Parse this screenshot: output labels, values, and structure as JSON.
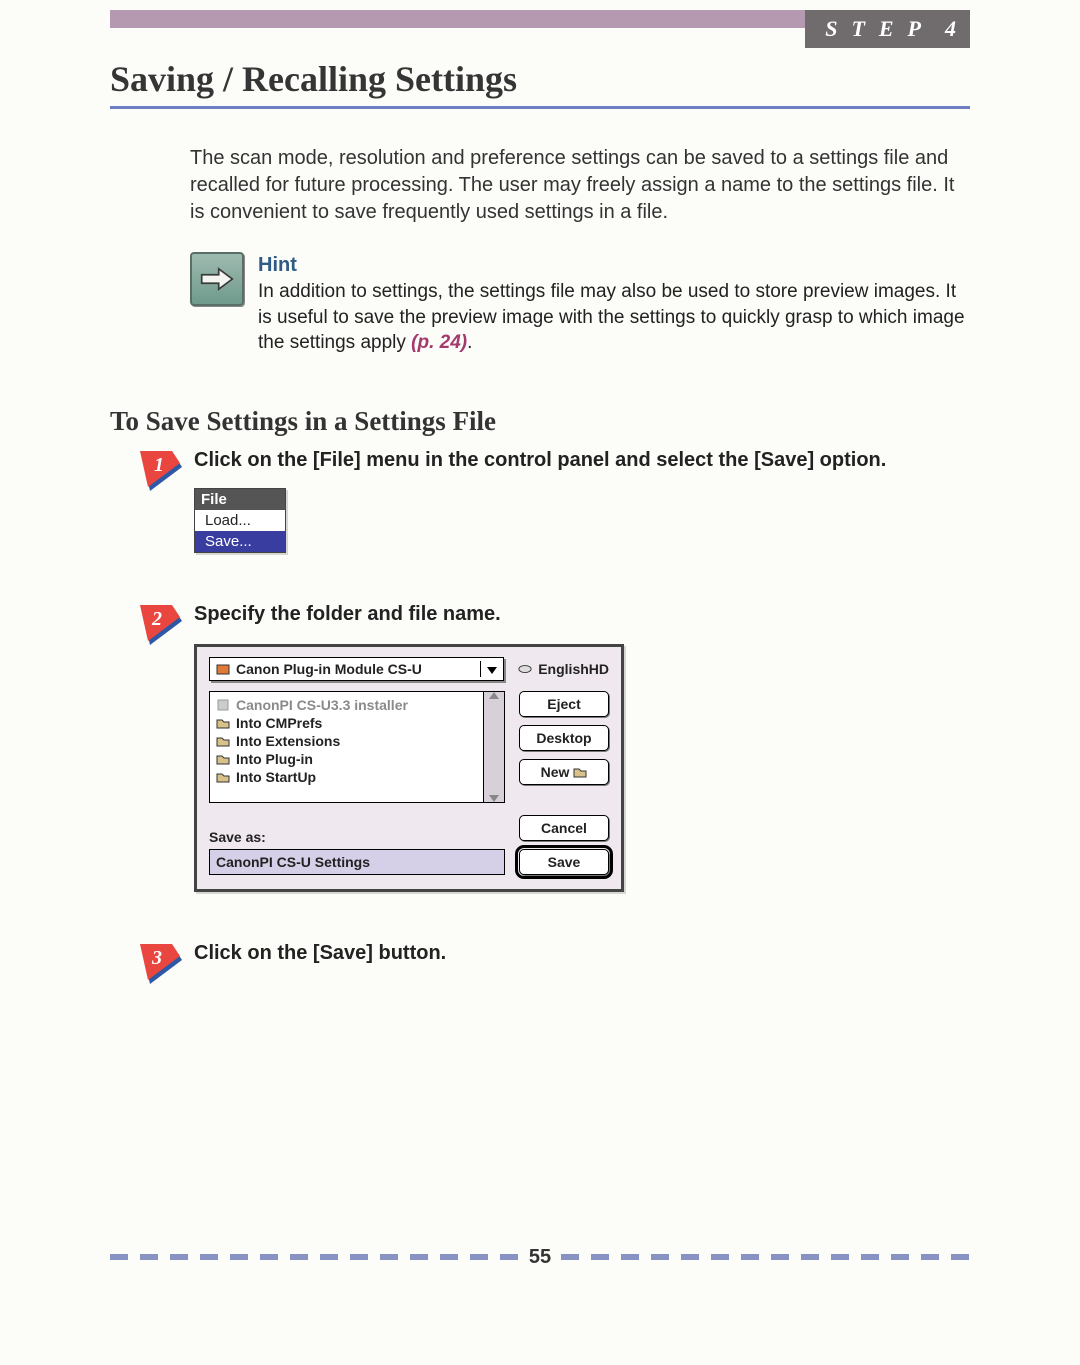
{
  "header": {
    "step_word": "STEP",
    "step_num": "4"
  },
  "title": "Saving / Recalling Settings",
  "intro": "The scan mode, resolution and preference settings can be saved to a settings file and recalled for future processing. The user may freely assign a name to the settings file. It is convenient to save frequently used settings in a file.",
  "hint": {
    "label": "Hint",
    "text": "In addition to settings, the settings file may also be used to store preview images. It is useful to save the preview image with the settings to quickly grasp to which image the settings apply ",
    "ref": "(p. 24)",
    "period": "."
  },
  "subheading": "To Save Settings in a Settings File",
  "steps": {
    "s1": "Click on the [File] menu in the control panel and select the [Save] option.",
    "s2": "Specify the folder and file name.",
    "s3": "Click on the [Save] button."
  },
  "filemenu": {
    "header": "File",
    "load": "Load...",
    "save": "Save..."
  },
  "dialog": {
    "combo": "Canon Plug-in Module CS-U",
    "disk": "EnglishHD",
    "list": {
      "i0": "CanonPI CS-U3.3 installer",
      "i1": "Into CMPrefs",
      "i2": "Into Extensions",
      "i3": "Into Plug-in",
      "i4": "Into StartUp"
    },
    "buttons": {
      "eject": "Eject",
      "desktop": "Desktop",
      "new": "New",
      "cancel": "Cancel",
      "save": "Save"
    },
    "saveas_label": "Save as:",
    "saveas_value": "CanonPI CS-U Settings"
  },
  "page_number": "55"
}
